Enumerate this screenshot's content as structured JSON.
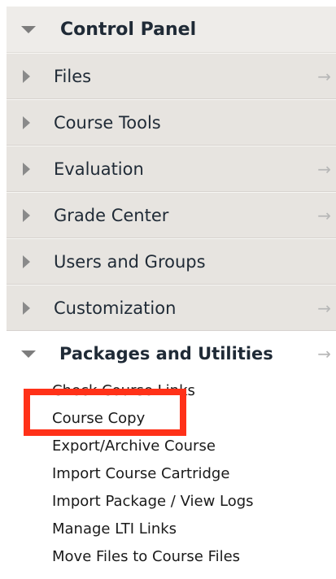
{
  "control_panel": {
    "title": "Control Panel",
    "items": [
      {
        "label": "Files",
        "has_arrow": true
      },
      {
        "label": "Course Tools",
        "has_arrow": false
      },
      {
        "label": "Evaluation",
        "has_arrow": true
      },
      {
        "label": "Grade Center",
        "has_arrow": true
      },
      {
        "label": "Users and Groups",
        "has_arrow": false
      },
      {
        "label": "Customization",
        "has_arrow": true
      }
    ],
    "open_section": {
      "label": "Packages and Utilities",
      "items": [
        "Check Course Links",
        "Course Copy",
        "Export/Archive Course",
        "Import Course Cartridge",
        "Import Package / View Logs",
        "Manage LTI Links",
        "Move Files to Course Files"
      ]
    },
    "arrow_glyph": "→",
    "highlight_color": "#ff3118"
  }
}
